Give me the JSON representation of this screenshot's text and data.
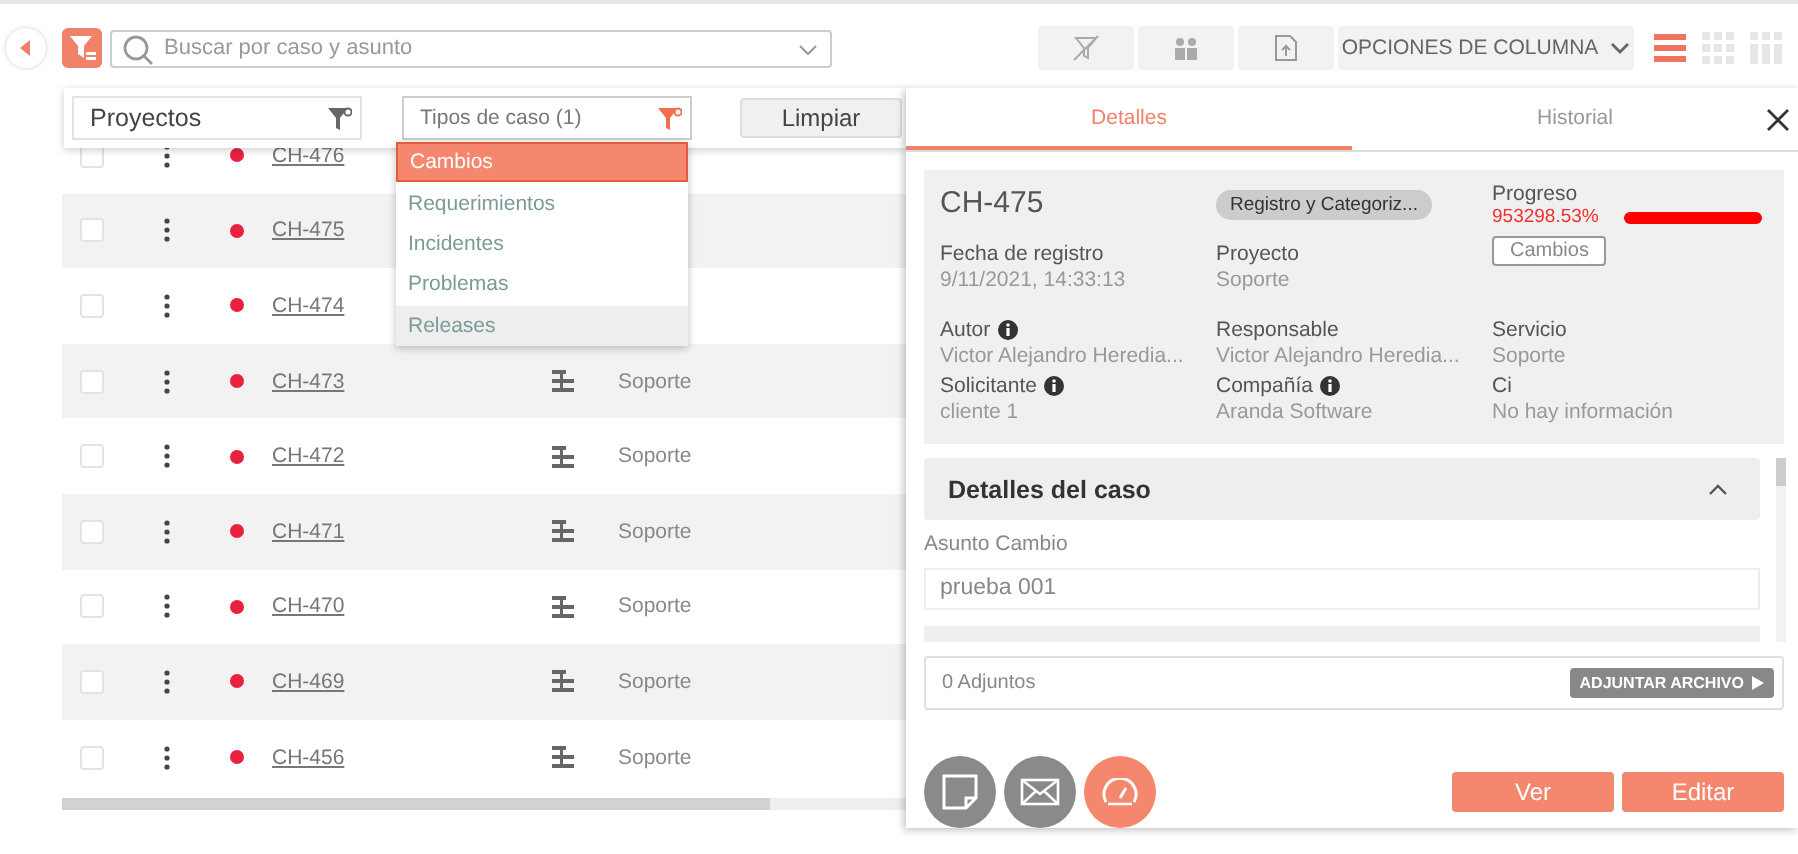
{
  "search": {
    "placeholder": "Buscar por caso y asunto"
  },
  "toolbar": {
    "column_options": "OPCIONES DE COLUMNA",
    "views": [
      {
        "kind": "list",
        "selected": true
      },
      {
        "kind": "grid",
        "selected": false
      },
      {
        "kind": "columns",
        "selected": false
      }
    ]
  },
  "filters": {
    "projects": "Proyectos",
    "case_types": "Tipos de caso (1)",
    "clear": "Limpiar",
    "options": [
      {
        "label": "Cambios",
        "selected": true
      },
      {
        "label": "Requerimientos",
        "selected": false
      },
      {
        "label": "Incidentes",
        "selected": false
      },
      {
        "label": "Problemas",
        "selected": false
      },
      {
        "label": "Releases",
        "selected": false
      }
    ]
  },
  "rows": [
    {
      "id": "CH-476",
      "checked": false,
      "color": "#e8213f"
    },
    {
      "id": "CH-475",
      "checked": false,
      "color": "#e8213f"
    },
    {
      "id": "CH-474",
      "checked": false,
      "color": "#e8213f"
    },
    {
      "id": "CH-473",
      "checked": false,
      "color": "#e8213f",
      "project": "Soporte"
    },
    {
      "id": "CH-472",
      "checked": false,
      "color": "#e8213f",
      "project": "Soporte"
    },
    {
      "id": "CH-471",
      "checked": false,
      "color": "#e8213f",
      "project": "Soporte"
    },
    {
      "id": "CH-470",
      "checked": false,
      "color": "#e8213f",
      "project": "Soporte"
    },
    {
      "id": "CH-469",
      "checked": false,
      "color": "#e8213f",
      "project": "Soporte"
    },
    {
      "id": "CH-456",
      "checked": false,
      "color": "#e8213f",
      "project": "Soporte"
    }
  ],
  "panel": {
    "tabs": [
      {
        "label": "Detalles",
        "selected": true
      },
      {
        "label": "Historial",
        "selected": false
      }
    ],
    "case_id": "CH-475",
    "stage": "Registro y Categoriz...",
    "progress_label": "Progreso",
    "progress_value": "953298.53%",
    "progress": {
      "level": 1
    },
    "case_type": "Cambios",
    "fields": [
      {
        "label": "Fecha de registro",
        "value": "9/11/2021, 14:33:13",
        "info": false
      },
      {
        "label": "Proyecto",
        "value": "Soporte",
        "info": false
      },
      {
        "label": "Autor",
        "value": "Victor Alejandro Heredia...",
        "info": true
      },
      {
        "label": "Responsable",
        "value": "Victor Alejandro Heredia...",
        "info": false
      },
      {
        "label": "Servicio",
        "value": "Soporte",
        "info": false
      },
      {
        "label": "Solicitante",
        "value": "cliente 1",
        "info": true
      },
      {
        "label": "Compañía",
        "value": "Aranda Software",
        "info": true
      },
      {
        "label": "Ci",
        "value": "No hay información",
        "info": false
      }
    ],
    "section": {
      "title": "Detalles del caso",
      "expanded": true
    },
    "subject_label": "Asunto Cambio",
    "subject": "prueba 001",
    "attachments": "0 Adjuntos",
    "attach_button": "ADJUNTAR ARCHIVO",
    "actions": [
      {
        "kind": "note",
        "selected": false
      },
      {
        "kind": "mail",
        "selected": false
      },
      {
        "kind": "gauge",
        "selected": true
      }
    ],
    "buttons": [
      "Ver",
      "Editar"
    ]
  }
}
